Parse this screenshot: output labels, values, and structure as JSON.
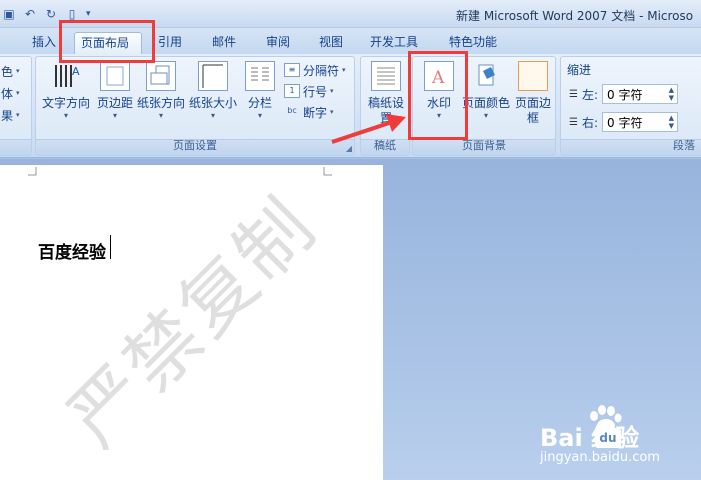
{
  "window": {
    "title": "新建 Microsoft Word 2007 文档 - Microso"
  },
  "tabs": [
    {
      "label": "插入",
      "active": false
    },
    {
      "label": "页面布局",
      "active": true
    },
    {
      "label": "引用",
      "active": false
    },
    {
      "label": "邮件",
      "active": false
    },
    {
      "label": "审阅",
      "active": false
    },
    {
      "label": "视图",
      "active": false
    },
    {
      "label": "开发工具",
      "active": false
    },
    {
      "label": "特色功能",
      "active": false
    }
  ],
  "ribbon": {
    "theme_partial": [
      "色",
      "体",
      "果"
    ],
    "page_setup": {
      "label": "页面设置",
      "text_direction": "文字方向",
      "margins": "页边距",
      "orientation": "纸张方向",
      "size": "纸张大小",
      "columns": "分栏",
      "breaks": "分隔符",
      "line_numbers": "行号",
      "hyphenation": "断字"
    },
    "draft": {
      "label": "稿纸",
      "settings": "稿纸设置"
    },
    "page_background": {
      "label": "页面背景",
      "watermark": "水印",
      "page_color": "页面颜色",
      "page_borders": "页面边框"
    },
    "paragraph": {
      "label": "段落",
      "indent_title": "缩进",
      "left_label": "左:",
      "left_value": "0 字符",
      "right_label": "右:",
      "right_value": "0 字符"
    }
  },
  "document": {
    "text": "百度经验",
    "watermark": "严禁复制"
  },
  "badge": {
    "logo": "Bai  经验",
    "du": "du",
    "url": "jingyan.baidu.com"
  },
  "colors": {
    "highlight": "#f03b3b",
    "ribbon_text": "#15428b"
  }
}
